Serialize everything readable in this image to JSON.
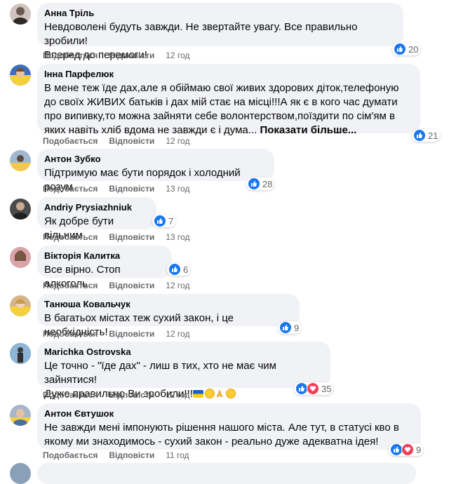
{
  "action_like": "Подобається",
  "action_reply": "Відповісти",
  "comments": [
    {
      "author": "Анна Тріль",
      "text": "Невдоволені будуть завжди. Не звертайте увагу. Все правильно зробили!\nВперед до перемоги!",
      "time": "12 год",
      "reactions": [
        "like"
      ],
      "count": "20",
      "avatar_color": "#cfc3bd"
    },
    {
      "author": "Інна Парфелюк",
      "text": "В мене теж їде дах,але я обіймаю свої живих здорових діток,телефоную до своїх ЖИВИХ батьків і дах мій стає на місці!!!А як є в кого час думати про випивку,то можна зайняти себе волонтерством,поїздити по сім'ям в яких навіть хліб вдома не завжди є і дума...",
      "more": "Показати більше...",
      "time": "12 год",
      "reactions": [
        "like"
      ],
      "count": "21",
      "avatar_color": "#3b6fb8"
    },
    {
      "author": "Антон Зубко",
      "text": "Підтримую має бути порядок і холодний розум",
      "time": "13 год",
      "reactions": [
        "like"
      ],
      "count": "28",
      "avatar_color": "#9fb7cf"
    },
    {
      "author": "Andriy Prysiazhniuk",
      "text": "Як добре бути вільним",
      "time": "13 год",
      "reactions": [
        "like"
      ],
      "count": "7",
      "avatar_color": "#4a4a4a"
    },
    {
      "author": "Вікторія Калитка",
      "text": "Все вірно. Стоп алкоголь.",
      "time": "12 год",
      "reactions": [
        "like"
      ],
      "count": "6",
      "avatar_color": "#d9a3a8"
    },
    {
      "author": "Танюша Ковальчук",
      "text": "В багатьох містах теж сухий закон, і це необхідність!",
      "time": "12 год",
      "reactions": [
        "like"
      ],
      "count": "9",
      "avatar_color": "#d7b58a"
    },
    {
      "author": "Marichka Ostrovska",
      "text": "Це точно - \"їде дах\" - лиш в тих, хто не має чим зайнятися!\nДуже правильно Ви зробили!!!",
      "time": "12 год",
      "reactions": [
        "like",
        "love"
      ],
      "count": "35",
      "avatar_color": "#6b8fb0"
    },
    {
      "author": "Антон Євтушок",
      "text": "Не завжди мені імпонують рішення нашого міста. Але тут, в статусі кво в якому ми знаходимось - сухий закон - реально дуже адекватна ідея!",
      "time": "11 год",
      "reactions": [
        "like",
        "love"
      ],
      "count": "9",
      "avatar_color": "#a7b6c9"
    }
  ]
}
